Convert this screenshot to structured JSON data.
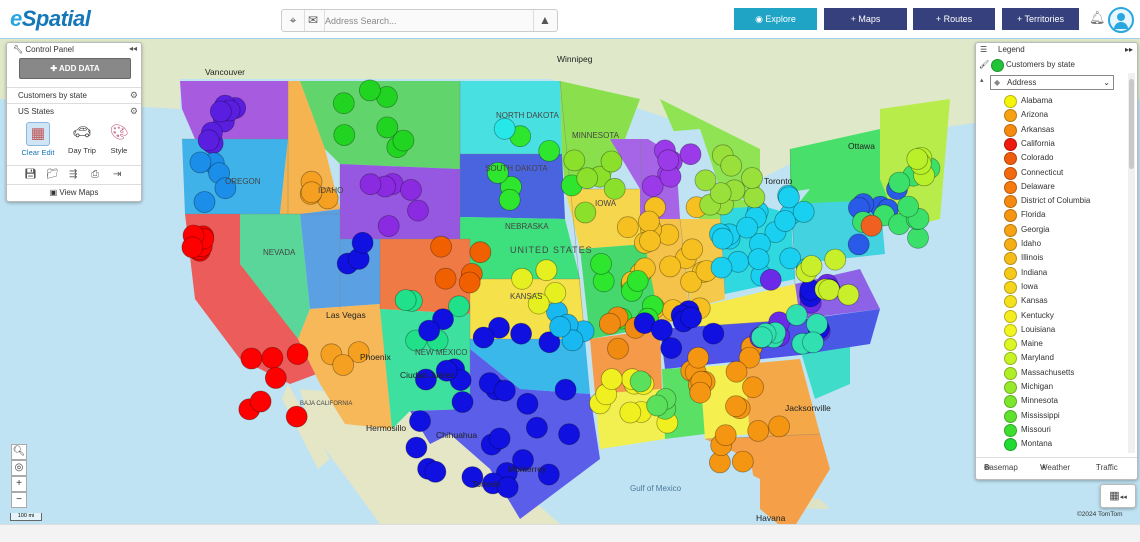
{
  "app": {
    "logo_prefix": "e",
    "logo_name": "Spatial",
    "search": {
      "placeholder": "Address Search..."
    },
    "nav": {
      "explore": "Explore",
      "maps": "+ Maps",
      "routes": "+ Routes",
      "territories": "+ Territories"
    }
  },
  "colors": {
    "accent": "#20a4c6",
    "nav_bg": "#35407c",
    "brand": "#1577b8"
  },
  "control_panel": {
    "title": "Control Panel",
    "add_data": "ADD DATA",
    "layers": [
      "Customers by state",
      "US States"
    ],
    "tools": {
      "clear": "Clear",
      "edit": "Edit",
      "day_trip": "Day Trip",
      "style": "Style"
    },
    "view_maps": "View Maps"
  },
  "legend": {
    "title": "Legend",
    "layer": "Customers by state",
    "field": "Address",
    "items": [
      {
        "name": "Alabama",
        "color": "#f5f50a"
      },
      {
        "name": "Arizona",
        "color": "#f6a214"
      },
      {
        "name": "Arkansas",
        "color": "#f58a10"
      },
      {
        "name": "California",
        "color": "#ee1b0f"
      },
      {
        "name": "Colorado",
        "color": "#f05c0e"
      },
      {
        "name": "Connecticut",
        "color": "#f26a0e"
      },
      {
        "name": "Delaware",
        "color": "#f57a10"
      },
      {
        "name": "District of Columbia",
        "color": "#f58a10"
      },
      {
        "name": "Florida",
        "color": "#f59612"
      },
      {
        "name": "Georgia",
        "color": "#f5a214"
      },
      {
        "name": "Idaho",
        "color": "#f5ae16"
      },
      {
        "name": "Illinois",
        "color": "#f5bc18"
      },
      {
        "name": "Indiana",
        "color": "#f5c81a"
      },
      {
        "name": "Iowa",
        "color": "#f5d41c"
      },
      {
        "name": "Kansas",
        "color": "#f5e01e"
      },
      {
        "name": "Kentucky",
        "color": "#f5ec20"
      },
      {
        "name": "Louisiana",
        "color": "#f2f522"
      },
      {
        "name": "Maine",
        "color": "#dcf524"
      },
      {
        "name": "Maryland",
        "color": "#c6f226"
      },
      {
        "name": "Massachusetts",
        "color": "#b0ee28"
      },
      {
        "name": "Michigan",
        "color": "#96ea2a"
      },
      {
        "name": "Minnesota",
        "color": "#7ce62c"
      },
      {
        "name": "Mississippi",
        "color": "#5ee22e"
      },
      {
        "name": "Missouri",
        "color": "#3ede30"
      },
      {
        "name": "Montana",
        "color": "#22da32"
      }
    ],
    "footer": {
      "basemap": "Basemap",
      "weather": "Weather",
      "traffic": "Traffic"
    }
  },
  "map": {
    "labels": {
      "vancouver": "Vancouver",
      "winnipeg": "Winnipeg",
      "ottawa": "Ottawa",
      "toronto": "Toronto",
      "united_states": "UNITED STATES",
      "nevada": "NEVADA",
      "new_mexico": "NEW MEXICO",
      "hermosillo": "Hermosillo",
      "chihuahua": "Chihuahua",
      "torreon": "Torreón",
      "monterrey": "Monterrey",
      "gulf": "Gulf of Mexico",
      "havana": "Havana",
      "jacksonville": "Jacksonville",
      "north_dakota": "NORTH DAKOTA",
      "south_dakota": "SOUTH DAKOTA",
      "nebraska": "NEBRASKA",
      "minnesota": "MINNESOTA",
      "iowa": "IOWA",
      "kansas": "KANSAS",
      "ciudad_juarez": "Ciudad Juárez",
      "phoenix": "Phoenix",
      "las_vegas": "Las Vegas",
      "oregon": "OREGON",
      "idaho": "IDAHO",
      "baja": "BAJA CALIFORNIA"
    },
    "scale": "100 mi",
    "copyright": "©2024 TomTom"
  }
}
